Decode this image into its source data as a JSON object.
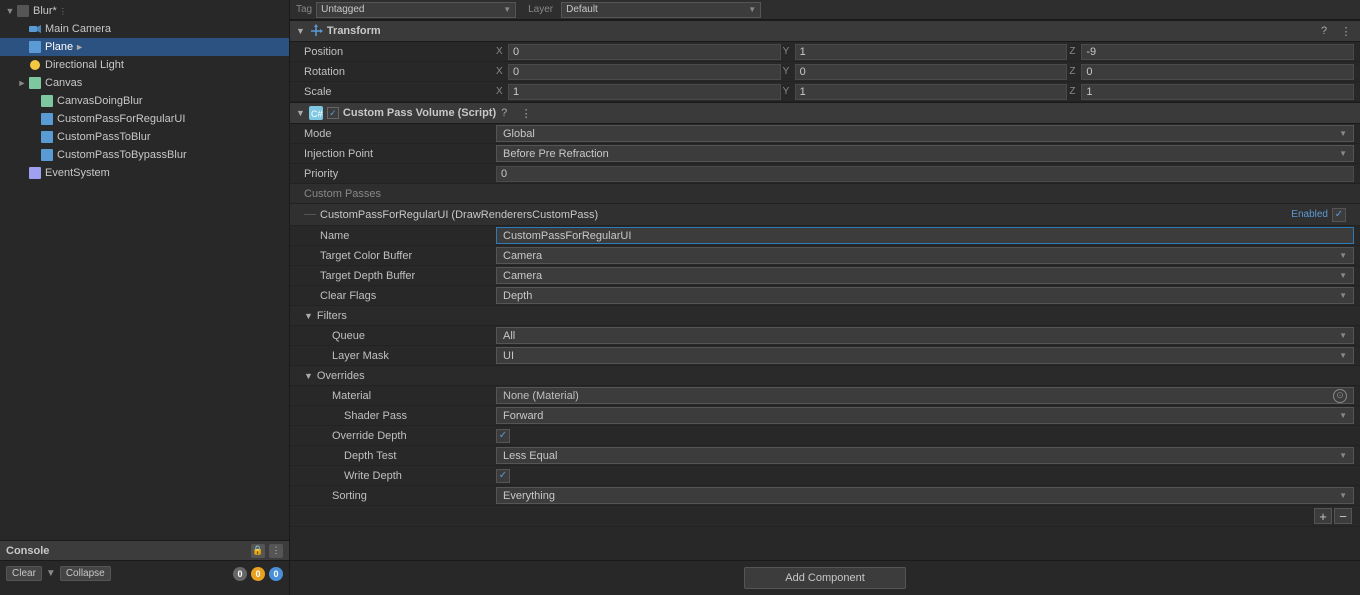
{
  "leftPanel": {
    "hierarchy": {
      "items": [
        {
          "id": "blur",
          "label": "Blur*",
          "indent": 0,
          "arrow": "expanded",
          "icon": "root",
          "selected": false
        },
        {
          "id": "main-camera",
          "label": "Main Camera",
          "indent": 1,
          "arrow": "empty",
          "icon": "camera",
          "selected": false
        },
        {
          "id": "plane",
          "label": "Plane",
          "indent": 1,
          "arrow": "empty",
          "icon": "cube",
          "selected": true
        },
        {
          "id": "directional-light",
          "label": "Directional Light",
          "indent": 1,
          "arrow": "empty",
          "icon": "light",
          "selected": false
        },
        {
          "id": "canvas",
          "label": "Canvas",
          "indent": 1,
          "arrow": "collapsed",
          "icon": "canvas",
          "selected": false
        },
        {
          "id": "canvas-doing-blur",
          "label": "CanvasDoingBlur",
          "indent": 2,
          "arrow": "empty",
          "icon": "canvas",
          "selected": false
        },
        {
          "id": "custom-pass-regular",
          "label": "CustomPassForRegularUI",
          "indent": 2,
          "arrow": "empty",
          "icon": "cube",
          "selected": false
        },
        {
          "id": "custom-pass-to-blur",
          "label": "CustomPassToBlur",
          "indent": 2,
          "arrow": "empty",
          "icon": "cube",
          "selected": false
        },
        {
          "id": "custom-pass-bypass",
          "label": "CustomPassToBypassBlur",
          "indent": 2,
          "arrow": "empty",
          "icon": "cube",
          "selected": false
        },
        {
          "id": "event-system",
          "label": "EventSystem",
          "indent": 1,
          "arrow": "empty",
          "icon": "eventSys",
          "selected": false
        }
      ]
    }
  },
  "console": {
    "title": "Console",
    "buttons": {
      "clear": "Clear",
      "collapse": "Collapse"
    },
    "badges": {
      "errors": "0",
      "warnings": "0",
      "info": "0"
    }
  },
  "rightPanel": {
    "tagRow": {
      "tagLabel": "Tag",
      "tagValue": "Untagged",
      "layerLabel": "Layer",
      "layerValue": "Default"
    },
    "transform": {
      "title": "Transform",
      "position": {
        "label": "Position",
        "x": "0",
        "y": "1",
        "z": "-9"
      },
      "rotation": {
        "label": "Rotation",
        "x": "0",
        "y": "0",
        "z": "0"
      },
      "scale": {
        "label": "Scale",
        "x": "1",
        "y": "1",
        "z": "1"
      }
    },
    "customPassVolume": {
      "title": "Custom Pass Volume (Script)",
      "mode": {
        "label": "Mode",
        "value": "Global"
      },
      "injectionPoint": {
        "label": "Injection Point",
        "value": "Before Pre Refraction"
      },
      "priority": {
        "label": "Priority",
        "value": "0"
      },
      "customPasses": {
        "sectionLabel": "Custom Passes",
        "passName": "CustomPassForRegularUI (DrawRenderersCustomPass)",
        "enabledLabel": "Enabled",
        "name": {
          "label": "Name",
          "value": "CustomPassForRegularUI"
        },
        "targetColorBuffer": {
          "label": "Target Color Buffer",
          "value": "Camera"
        },
        "targetDepthBuffer": {
          "label": "Target Depth Buffer",
          "value": "Camera"
        },
        "clearFlags": {
          "label": "Clear Flags",
          "value": "Depth"
        },
        "filters": {
          "label": "Filters",
          "queue": {
            "label": "Queue",
            "value": "All"
          },
          "layerMask": {
            "label": "Layer Mask",
            "value": "UI"
          }
        },
        "overrides": {
          "label": "Overrides",
          "material": {
            "label": "Material",
            "value": "None (Material)"
          },
          "shaderPass": {
            "label": "Shader Pass",
            "value": "Forward"
          },
          "overrideDepth": {
            "label": "Override Depth",
            "checked": true
          },
          "depthTest": {
            "label": "Depth Test",
            "value": "Less Equal"
          },
          "writeDepth": {
            "label": "Write Depth",
            "checked": true
          },
          "sorting": {
            "label": "Sorting",
            "value": "Everything"
          }
        }
      }
    },
    "addComponent": "Add Component"
  }
}
